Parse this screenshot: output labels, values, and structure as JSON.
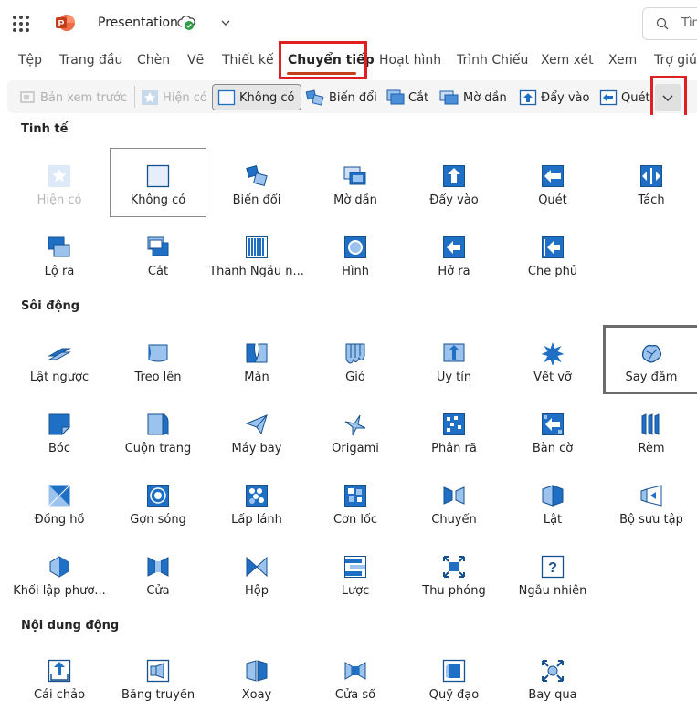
{
  "titlebar": {
    "doc_title": "Presentation",
    "search_placeholder": "Tìm"
  },
  "tabs": [
    {
      "label": "Tệp"
    },
    {
      "label": "Trang đầu"
    },
    {
      "label": "Chèn"
    },
    {
      "label": "Vẽ"
    },
    {
      "label": "Thiết kế"
    },
    {
      "label": "Chuyển tiếp",
      "active": true
    },
    {
      "label": "Hoạt hình"
    },
    {
      "label": "Trình Chiếu"
    },
    {
      "label": "Xem xét"
    },
    {
      "label": "Xem"
    },
    {
      "label": "Trợ giúp"
    }
  ],
  "ribbon": {
    "preview": "Bản xem trước",
    "appear": "Hiện có",
    "none": "Không có",
    "morph": "Biến đổi",
    "cut": "Cắt",
    "fade": "Mờ dần",
    "push": "Đẩy vào",
    "wipe": "Quét"
  },
  "gallery": {
    "sections": [
      {
        "title": "Tinh tế",
        "rows": [
          [
            {
              "label": "Hiện có",
              "icon": "appear",
              "disabled": true
            },
            {
              "label": "Không có",
              "icon": "none",
              "selected": true
            },
            {
              "label": "Biến đổi",
              "icon": "morph"
            },
            {
              "label": "Mờ dần",
              "icon": "fade"
            },
            {
              "label": "Đẩy vào",
              "icon": "push"
            },
            {
              "label": "Quét",
              "icon": "wipe"
            },
            {
              "label": "Tách",
              "icon": "split"
            }
          ],
          [
            {
              "label": "Lộ ra",
              "icon": "reveal"
            },
            {
              "label": "Cắt",
              "icon": "cut"
            },
            {
              "label": "Thanh Ngẫu n...",
              "icon": "random-bars"
            },
            {
              "label": "Hình",
              "icon": "shape"
            },
            {
              "label": "Hở ra",
              "icon": "uncover"
            },
            {
              "label": "Che phủ",
              "icon": "cover"
            }
          ]
        ]
      },
      {
        "title": "Sôi động",
        "rows": [
          [
            {
              "label": "Lật ngược",
              "icon": "fall-over"
            },
            {
              "label": "Treo lên",
              "icon": "drape"
            },
            {
              "label": "Màn",
              "icon": "curtains"
            },
            {
              "label": "Gió",
              "icon": "wind"
            },
            {
              "label": "Uy tín",
              "icon": "prestige"
            },
            {
              "label": "Vết vỡ",
              "icon": "fracture"
            },
            {
              "label": "Say đắm",
              "icon": "crush",
              "hover": true
            }
          ],
          [
            {
              "label": "Bóc",
              "icon": "peel-off"
            },
            {
              "label": "Cuộn trang",
              "icon": "page-curl"
            },
            {
              "label": "Máy bay",
              "icon": "airplane"
            },
            {
              "label": "Origami",
              "icon": "origami"
            },
            {
              "label": "Phân rã",
              "icon": "dissolve"
            },
            {
              "label": "Bàn cờ",
              "icon": "checkerboard"
            },
            {
              "label": "Rèm",
              "icon": "blinds"
            }
          ],
          [
            {
              "label": "Đồng hồ",
              "icon": "clock"
            },
            {
              "label": "Gợn sóng",
              "icon": "ripple"
            },
            {
              "label": "Lấp lánh",
              "icon": "honeycomb"
            },
            {
              "label": "Cơn lốc",
              "icon": "vortex"
            },
            {
              "label": "Chuyển",
              "icon": "switch"
            },
            {
              "label": "Lật",
              "icon": "flip"
            },
            {
              "label": "Bộ sưu tập",
              "icon": "gallery"
            }
          ],
          [
            {
              "label": "Khối lập phươ...",
              "icon": "cube"
            },
            {
              "label": "Cửa",
              "icon": "doors"
            },
            {
              "label": "Hộp",
              "icon": "box"
            },
            {
              "label": "Lược",
              "icon": "comb"
            },
            {
              "label": "Thu phóng",
              "icon": "zoom"
            },
            {
              "label": "Ngẫu nhiên",
              "icon": "random"
            }
          ]
        ]
      },
      {
        "title": "Nội dung động",
        "rows": [
          [
            {
              "label": "Cái chảo",
              "icon": "pan"
            },
            {
              "label": "Băng truyền",
              "icon": "conveyor"
            },
            {
              "label": "Xoay",
              "icon": "rotate"
            },
            {
              "label": "Cửa sổ",
              "icon": "window"
            },
            {
              "label": "Quỹ đạo",
              "icon": "orbit"
            },
            {
              "label": "Bay qua",
              "icon": "fly-through"
            }
          ]
        ]
      }
    ]
  }
}
